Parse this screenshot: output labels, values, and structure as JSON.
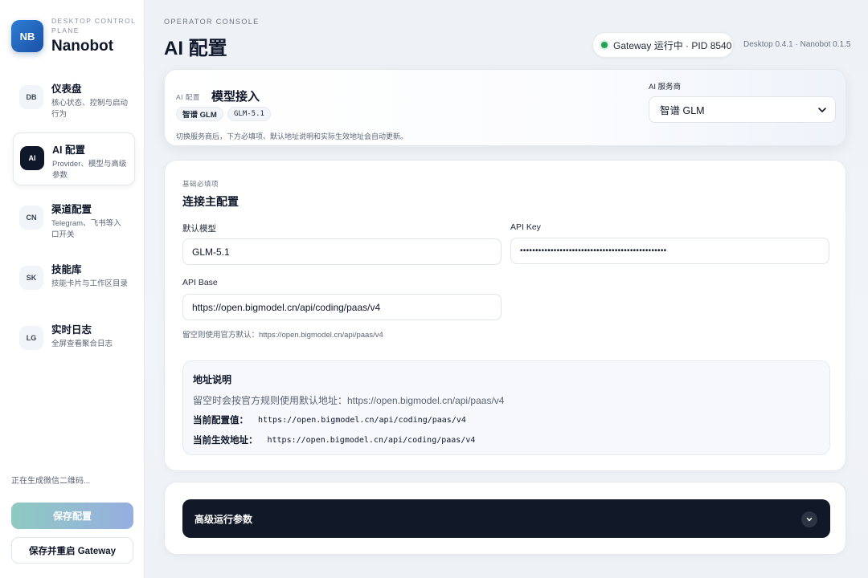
{
  "brand": {
    "logo": "NB",
    "subtitle": "DESKTOP CONTROL PLANE",
    "name": "Nanobot"
  },
  "nav": [
    {
      "badge": "DB",
      "title": "仪表盘",
      "desc": "核心状态、控制与启动行为",
      "active": false
    },
    {
      "badge": "AI",
      "title": "AI 配置",
      "desc": "Provider、模型与高级参数",
      "active": true
    },
    {
      "badge": "CN",
      "title": "渠道配置",
      "desc": "Telegram、飞书等入口开关",
      "active": false
    },
    {
      "badge": "SK",
      "title": "技能库",
      "desc": "技能卡片与工作区目录",
      "active": false
    },
    {
      "badge": "LG",
      "title": "实时日志",
      "desc": "全屏查看聚合日志",
      "active": false
    }
  ],
  "sidebar_footer": {
    "status": "正在生成微信二维码...",
    "save_label": "保存配置",
    "restart_label": "保存并重启 Gateway"
  },
  "header": {
    "eyebrow": "OPERATOR CONSOLE",
    "title": "AI 配置",
    "gateway_status": "Gateway 运行中 · PID 8540",
    "version": "Desktop 0.4.1 · Nanobot 0.1.5",
    "status_color": "#22a356"
  },
  "provider_card": {
    "eyebrow": "AI 配置",
    "title": "模型接入",
    "chips": [
      "智谱 GLM",
      "GLM-5.1"
    ],
    "hint": "切换服务商后，下方必填项、默认地址说明和实际生效地址会自动更新。",
    "select_label": "AI 服务商",
    "select_value": "智谱 GLM"
  },
  "connection": {
    "eyebrow": "基础必填项",
    "title": "连接主配置",
    "model_label": "默认模型",
    "model_value": "GLM-5.1",
    "key_label": "API Key",
    "key_value": "••••••••••••••••••••••••••••••••••••••••••••••••",
    "base_label": "API Base",
    "base_value": "https://open.bigmodel.cn/api/coding/paas/v4",
    "base_hint": "留空则使用官方默认：https://open.bigmodel.cn/api/paas/v4"
  },
  "address": {
    "title": "地址说明",
    "default_line": "留空时会按官方规则使用默认地址：https://open.bigmodel.cn/api/paas/v4",
    "current_label": "当前配置值：",
    "current_value": "https://open.bigmodel.cn/api/coding/paas/v4",
    "effective_label": "当前生效地址：",
    "effective_value": "https://open.bigmodel.cn/api/coding/paas/v4"
  },
  "advanced": {
    "title": "高级运行参数",
    "toggle_icon": "chevron-down-icon"
  }
}
